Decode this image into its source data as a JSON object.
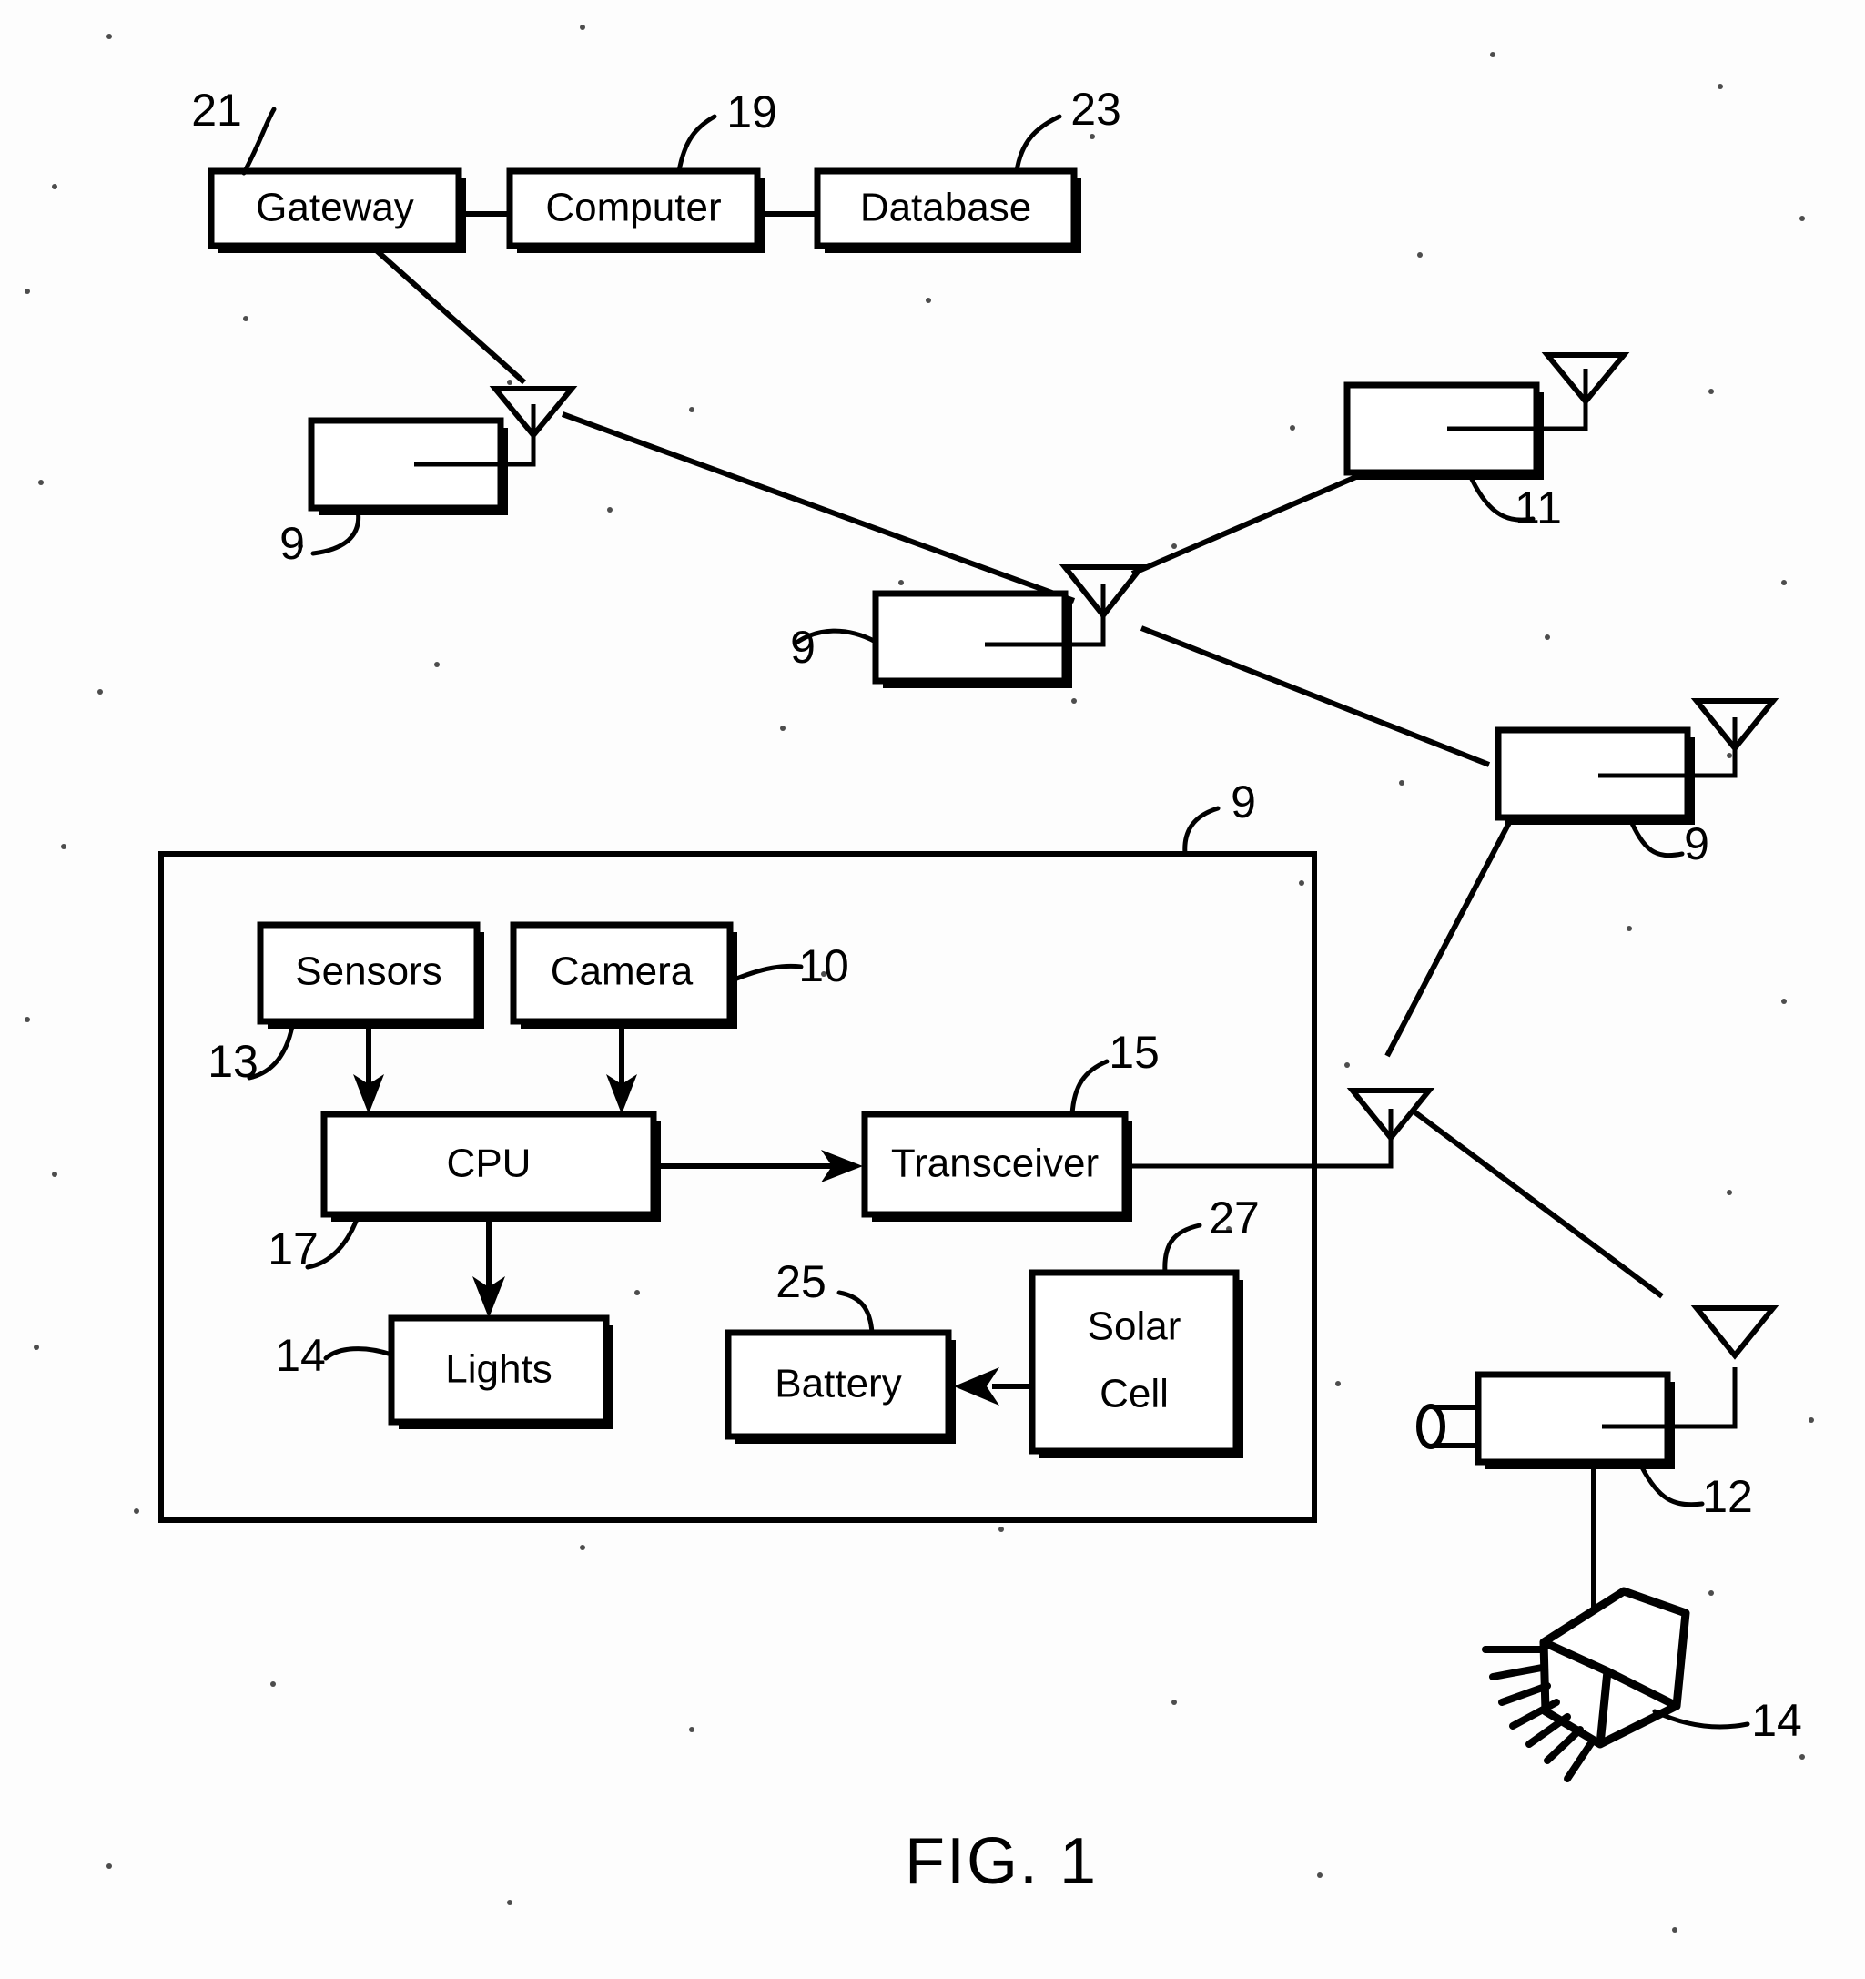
{
  "figure": {
    "caption": "FIG. 1",
    "top_blocks": [
      {
        "id": "gateway",
        "label": "Gateway",
        "ref": "21"
      },
      {
        "id": "computer",
        "label": "Computer",
        "ref": "19"
      },
      {
        "id": "database",
        "label": "Database",
        "ref": "23"
      }
    ],
    "network_nodes": [
      {
        "id": "node-upper-left",
        "ref": "9",
        "kind": "sensor-node"
      },
      {
        "id": "node-center",
        "ref": "9",
        "kind": "sensor-node"
      },
      {
        "id": "node-upper-right",
        "ref": "11",
        "kind": "sensor-node"
      },
      {
        "id": "node-right",
        "ref": "9",
        "kind": "sensor-node"
      },
      {
        "id": "node-camera",
        "ref": "12",
        "kind": "camera-node"
      }
    ],
    "detail_box": {
      "ref": "9",
      "blocks": [
        {
          "id": "sensors",
          "label": "Sensors",
          "ref": "13"
        },
        {
          "id": "camera",
          "label": "Camera",
          "ref": "10"
        },
        {
          "id": "cpu",
          "label": "CPU",
          "ref": "17"
        },
        {
          "id": "transceiver",
          "label": "Transceiver",
          "ref": "15"
        },
        {
          "id": "lights",
          "label": "Lights",
          "ref": "14"
        },
        {
          "id": "battery",
          "label": "Battery",
          "ref": "25"
        },
        {
          "id": "solar-cell",
          "label_line1": "Solar",
          "label_line2": "Cell",
          "ref": "27"
        }
      ]
    },
    "lamp_fixture": {
      "id": "street-light",
      "ref": "14"
    },
    "colors": {
      "ink": "#000000",
      "paper": "#ffffff"
    }
  }
}
